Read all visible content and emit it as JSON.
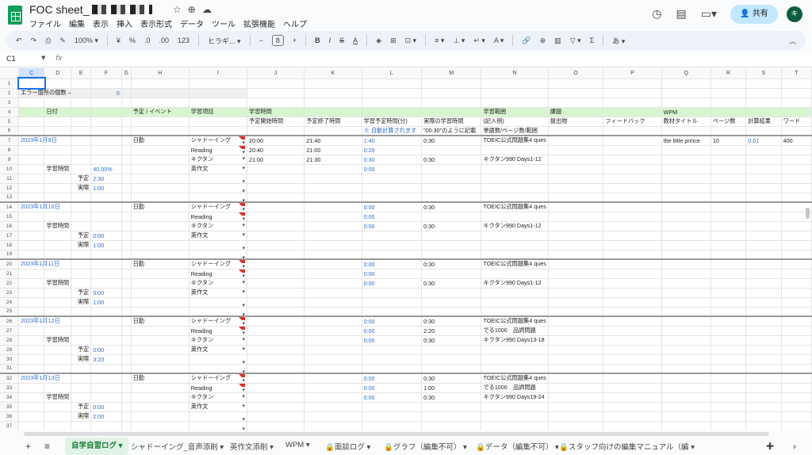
{
  "app": {
    "title": "FOC sheet_",
    "menu": [
      "ファイル",
      "編集",
      "表示",
      "挿入",
      "表示形式",
      "データ",
      "ツール",
      "拡張機能",
      "ヘルプ"
    ],
    "share_label": "共有",
    "avatar_letter": "キ"
  },
  "toolbar": {
    "zoom": "100%",
    "currency": "¥",
    "percent": "%",
    "dec_less": ".0",
    "dec_more": ".00",
    "num_fmt": "123",
    "font": "ヒラギ...",
    "font_size": "8",
    "bold": "B",
    "italic": "I",
    "strike": "S",
    "text_color": "A",
    "input_tool": "あ"
  },
  "formula": {
    "namebox": "C1",
    "fx": "fx"
  },
  "columns": [
    "C",
    "D",
    "E",
    "F",
    "G",
    "H",
    "I",
    "J",
    "K",
    "L",
    "M",
    "N",
    "O",
    "P",
    "Q",
    "R",
    "S",
    "T"
  ],
  "rows": [
    {
      "n": "1",
      "cells": []
    },
    {
      "n": "2",
      "cells": [
        {
          "c": "C",
          "t": "エラー箇所の個数→",
          "span": 3
        },
        {
          "c": "F",
          "t": "0",
          "cls": "blue right"
        }
      ],
      "gray": true
    },
    {
      "n": "3",
      "cells": []
    },
    {
      "n": "4",
      "band": true,
      "cells": [
        {
          "c": "D",
          "t": "日付"
        },
        {
          "c": "H",
          "t": "予定 / イベント"
        },
        {
          "c": "I",
          "t": "学習項目"
        },
        {
          "c": "J",
          "t": "学習時間"
        },
        {
          "c": "N",
          "t": "学習範囲"
        },
        {
          "c": "O",
          "t": "課題"
        },
        {
          "c": "Q",
          "t": "WPM"
        }
      ]
    },
    {
      "n": "5",
      "cells": [
        {
          "c": "J",
          "t": "予定開始時間"
        },
        {
          "c": "K",
          "t": "予定終了時間"
        },
        {
          "c": "L",
          "t": "学習予定時間(分)"
        },
        {
          "c": "M",
          "t": "実際の学習時間"
        },
        {
          "c": "N",
          "t": "(記入例)"
        },
        {
          "c": "O",
          "t": "提出物"
        },
        {
          "c": "P",
          "t": "フィードバック"
        },
        {
          "c": "Q",
          "t": "教材タイトル"
        },
        {
          "c": "R",
          "t": "ページ数"
        },
        {
          "c": "S",
          "t": "計算結果"
        },
        {
          "c": "T",
          "t": "ワード"
        }
      ]
    },
    {
      "n": "6",
      "cells": [
        {
          "c": "L",
          "t": "※ 自動計算されます",
          "cls": "blue"
        },
        {
          "c": "M",
          "t": "\"00:30\"のように記載"
        },
        {
          "c": "N",
          "t": "単語数/ページ数/範囲"
        }
      ]
    },
    {
      "n": "7",
      "sep": true,
      "cells": [
        {
          "c": "C",
          "t": "2023年1月9日",
          "cls": "blue",
          "span": 2
        },
        {
          "c": "H",
          "t": "日勤"
        },
        {
          "c": "I",
          "t": "シャドーイング",
          "dd": true,
          "tri": true
        },
        {
          "c": "J",
          "t": "20:00"
        },
        {
          "c": "K",
          "t": "21:40"
        },
        {
          "c": "L",
          "t": "1:40",
          "cls": "blue"
        },
        {
          "c": "M",
          "t": "0:30"
        },
        {
          "c": "N",
          "t": "TOEIC公式問題集4 ques"
        },
        {
          "c": "Q",
          "t": "the little prince"
        },
        {
          "c": "R",
          "t": "10"
        },
        {
          "c": "S",
          "t": "0.01",
          "cls": "blue"
        },
        {
          "c": "T",
          "t": "400"
        }
      ]
    },
    {
      "n": "8",
      "cells": [
        {
          "c": "I",
          "t": "Reading",
          "dd": true,
          "tri": true
        },
        {
          "c": "J",
          "t": "20:40"
        },
        {
          "c": "K",
          "t": "21:00"
        },
        {
          "c": "L",
          "t": "0:20",
          "cls": "blue"
        }
      ]
    },
    {
      "n": "9",
      "cells": [
        {
          "c": "I",
          "t": "キクタン",
          "dd": true
        },
        {
          "c": "J",
          "t": "21:00"
        },
        {
          "c": "K",
          "t": "21:30"
        },
        {
          "c": "L",
          "t": "0:30",
          "cls": "blue"
        },
        {
          "c": "M",
          "t": "0:30"
        },
        {
          "c": "N",
          "t": "キクタン990 Days1-12"
        }
      ]
    },
    {
      "n": "10",
      "cells": [
        {
          "c": "D",
          "t": "学習時間",
          "cls": "right"
        },
        {
          "c": "F",
          "t": "40.00%",
          "cls": "blue"
        },
        {
          "c": "I",
          "t": "英作文",
          "dd": true
        },
        {
          "c": "L",
          "t": "0:00",
          "cls": "blue"
        }
      ]
    },
    {
      "n": "11",
      "cells": [
        {
          "c": "E",
          "t": "予定",
          "cls": "right"
        },
        {
          "c": "F",
          "t": "2:30",
          "cls": "blue"
        },
        {
          "c": "I",
          "t": "",
          "dd": true
        }
      ]
    },
    {
      "n": "12",
      "cells": [
        {
          "c": "E",
          "t": "実際",
          "cls": "right"
        },
        {
          "c": "F",
          "t": "1:00",
          "cls": "blue"
        },
        {
          "c": "I",
          "t": "",
          "dd": true
        }
      ]
    },
    {
      "n": "13",
      "cells": [
        {
          "c": "I",
          "t": "",
          "dd": true
        }
      ]
    },
    {
      "n": "14",
      "sep": true,
      "cells": [
        {
          "c": "C",
          "t": "2023年1月10日",
          "cls": "blue",
          "span": 2
        },
        {
          "c": "H",
          "t": "日勤"
        },
        {
          "c": "I",
          "t": "シャドーイング",
          "dd": true,
          "tri": true
        },
        {
          "c": "L",
          "t": "0:00",
          "cls": "blue"
        },
        {
          "c": "M",
          "t": "0:30"
        },
        {
          "c": "N",
          "t": "TOEIC公式問題集4 ques"
        }
      ]
    },
    {
      "n": "15",
      "cells": [
        {
          "c": "I",
          "t": "Reading",
          "dd": true,
          "tri": true
        },
        {
          "c": "L",
          "t": "0:00",
          "cls": "blue"
        }
      ]
    },
    {
      "n": "16",
      "cells": [
        {
          "c": "D",
          "t": "学習時間",
          "cls": "right"
        },
        {
          "c": "I",
          "t": "キクタン",
          "dd": true
        },
        {
          "c": "L",
          "t": "0:00",
          "cls": "blue"
        },
        {
          "c": "M",
          "t": "0:30"
        },
        {
          "c": "N",
          "t": "キクタン990 Days1-12"
        }
      ]
    },
    {
      "n": "17",
      "cells": [
        {
          "c": "E",
          "t": "予定",
          "cls": "right"
        },
        {
          "c": "F",
          "t": "0:00",
          "cls": "blue"
        },
        {
          "c": "I",
          "t": "英作文",
          "dd": true
        }
      ]
    },
    {
      "n": "18",
      "cells": [
        {
          "c": "E",
          "t": "実際",
          "cls": "right"
        },
        {
          "c": "F",
          "t": "1:00",
          "cls": "blue"
        },
        {
          "c": "I",
          "t": "",
          "dd": true
        }
      ]
    },
    {
      "n": "19",
      "cells": [
        {
          "c": "I",
          "t": "",
          "dd": true
        }
      ]
    },
    {
      "n": "20",
      "sep": true,
      "cells": [
        {
          "c": "C",
          "t": "2023年1月11日",
          "cls": "blue",
          "span": 2
        },
        {
          "c": "H",
          "t": "日勤"
        },
        {
          "c": "I",
          "t": "シャドーイング",
          "dd": true,
          "tri": true
        },
        {
          "c": "L",
          "t": "0:00",
          "cls": "blue"
        },
        {
          "c": "M",
          "t": "0:30"
        },
        {
          "c": "N",
          "t": "TOEIC公式問題集4 ques"
        }
      ]
    },
    {
      "n": "21",
      "cells": [
        {
          "c": "I",
          "t": "Reading",
          "dd": true,
          "tri": true
        },
        {
          "c": "L",
          "t": "0:00",
          "cls": "blue"
        }
      ]
    },
    {
      "n": "22",
      "cells": [
        {
          "c": "D",
          "t": "学習時間",
          "cls": "right"
        },
        {
          "c": "I",
          "t": "キクタン",
          "dd": true
        },
        {
          "c": "L",
          "t": "0:00",
          "cls": "blue"
        },
        {
          "c": "M",
          "t": "0:30"
        },
        {
          "c": "N",
          "t": "キクタン990 Days1-12"
        }
      ]
    },
    {
      "n": "23",
      "cells": [
        {
          "c": "E",
          "t": "予定",
          "cls": "right"
        },
        {
          "c": "F",
          "t": "0:00",
          "cls": "blue"
        },
        {
          "c": "I",
          "t": "英作文",
          "dd": true
        }
      ]
    },
    {
      "n": "24",
      "cells": [
        {
          "c": "E",
          "t": "実際",
          "cls": "right"
        },
        {
          "c": "F",
          "t": "1:00",
          "cls": "blue"
        },
        {
          "c": "I",
          "t": "",
          "dd": true
        }
      ]
    },
    {
      "n": "25",
      "cells": [
        {
          "c": "I",
          "t": "",
          "dd": true
        }
      ]
    },
    {
      "n": "26",
      "sep": true,
      "cells": [
        {
          "c": "C",
          "t": "2023年1月12日",
          "cls": "blue",
          "span": 2
        },
        {
          "c": "H",
          "t": "日勤"
        },
        {
          "c": "I",
          "t": "シャドーイング",
          "dd": true,
          "tri": true
        },
        {
          "c": "L",
          "t": "0:00",
          "cls": "blue"
        },
        {
          "c": "M",
          "t": "0:30"
        },
        {
          "c": "N",
          "t": "TOEIC公式問題集4 ques"
        }
      ]
    },
    {
      "n": "27",
      "cells": [
        {
          "c": "I",
          "t": "Reading",
          "dd": true,
          "tri": true
        },
        {
          "c": "L",
          "t": "0:00",
          "cls": "blue"
        },
        {
          "c": "M",
          "t": "2:20"
        },
        {
          "c": "N",
          "t": "でる1000　品詞問題"
        }
      ]
    },
    {
      "n": "28",
      "cells": [
        {
          "c": "D",
          "t": "学習時間",
          "cls": "right"
        },
        {
          "c": "I",
          "t": "キクタン",
          "dd": true
        },
        {
          "c": "L",
          "t": "0:00",
          "cls": "blue"
        },
        {
          "c": "M",
          "t": "0:30"
        },
        {
          "c": "N",
          "t": "キクタン990 Days13-18"
        }
      ]
    },
    {
      "n": "29",
      "cells": [
        {
          "c": "E",
          "t": "予定",
          "cls": "right"
        },
        {
          "c": "F",
          "t": "0:00",
          "cls": "blue"
        },
        {
          "c": "I",
          "t": "英作文",
          "dd": true
        }
      ]
    },
    {
      "n": "30",
      "cells": [
        {
          "c": "E",
          "t": "実際",
          "cls": "right"
        },
        {
          "c": "F",
          "t": "3:20",
          "cls": "blue"
        },
        {
          "c": "I",
          "t": "",
          "dd": true
        }
      ]
    },
    {
      "n": "31",
      "cells": [
        {
          "c": "I",
          "t": "",
          "dd": true
        }
      ]
    },
    {
      "n": "32",
      "sep": true,
      "cells": [
        {
          "c": "C",
          "t": "2023年1月13日",
          "cls": "blue",
          "span": 2
        },
        {
          "c": "H",
          "t": "日勤"
        },
        {
          "c": "I",
          "t": "シャドーイング",
          "dd": true,
          "tri": true
        },
        {
          "c": "L",
          "t": "0:00",
          "cls": "blue"
        },
        {
          "c": "M",
          "t": "0:30"
        },
        {
          "c": "N",
          "t": "TOEIC公式問題集4 ques"
        }
      ]
    },
    {
      "n": "33",
      "cells": [
        {
          "c": "I",
          "t": "Reading",
          "dd": true,
          "tri": true
        },
        {
          "c": "L",
          "t": "0:00",
          "cls": "blue"
        },
        {
          "c": "M",
          "t": "1:00"
        },
        {
          "c": "N",
          "t": "でる1000　品詞問題"
        }
      ]
    },
    {
      "n": "34",
      "cells": [
        {
          "c": "D",
          "t": "学習時間",
          "cls": "right"
        },
        {
          "c": "I",
          "t": "キクタン",
          "dd": true
        },
        {
          "c": "L",
          "t": "0:00",
          "cls": "blue"
        },
        {
          "c": "M",
          "t": "0:30"
        },
        {
          "c": "N",
          "t": "キクタン990 Days19-24"
        }
      ]
    },
    {
      "n": "35",
      "cells": [
        {
          "c": "E",
          "t": "予定",
          "cls": "right"
        },
        {
          "c": "F",
          "t": "0:00",
          "cls": "blue"
        },
        {
          "c": "I",
          "t": "英作文",
          "dd": true
        }
      ]
    },
    {
      "n": "36",
      "cells": [
        {
          "c": "E",
          "t": "実際",
          "cls": "right"
        },
        {
          "c": "F",
          "t": "2:00",
          "cls": "blue"
        },
        {
          "c": "I",
          "t": "",
          "dd": true
        }
      ]
    },
    {
      "n": "37",
      "cells": [
        {
          "c": "I",
          "t": "",
          "dd": true
        }
      ]
    }
  ],
  "tabs": [
    "自学自習ログ",
    "シャドーイング_音声添削",
    "英作文添削",
    "WPM",
    "面談ログ",
    "グラフ（編集不可）",
    "データ（編集不可）",
    "スタッフ向けの編集マニュアル（編"
  ],
  "colors": {
    "band": "#d9f5d0",
    "active_tab": "#188038",
    "link_blue": "#2f6ec7"
  }
}
